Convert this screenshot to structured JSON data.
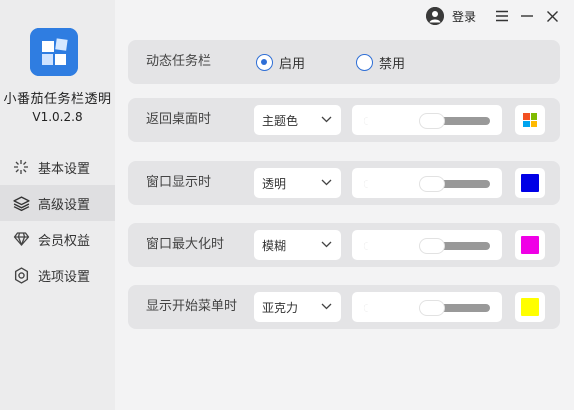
{
  "app": {
    "name": "小番茄任务栏透明",
    "version": "V1.0.2.8"
  },
  "sidebar": {
    "items": [
      {
        "label": "基本设置",
        "icon": "sparkle-icon",
        "active": false
      },
      {
        "label": "高级设置",
        "icon": "layers-icon",
        "active": true
      },
      {
        "label": "会员权益",
        "icon": "diamond-icon",
        "active": false
      },
      {
        "label": "选项设置",
        "icon": "gear-icon",
        "active": false
      }
    ]
  },
  "header": {
    "login_label": "登录",
    "icons": [
      "avatar-icon",
      "menu-icon",
      "minimize-icon",
      "close-icon"
    ]
  },
  "dynamic_taskbar": {
    "label": "动态任务栏",
    "options": [
      {
        "label": "启用",
        "selected": true
      },
      {
        "label": "禁用",
        "selected": false
      }
    ]
  },
  "settings_rows": [
    {
      "label": "返回桌面时",
      "mode": "主题色",
      "slider_value": 0.54,
      "color": "theme",
      "color_icon": "windows-logo-icon"
    },
    {
      "label": "窗口显示时",
      "mode": "透明",
      "slider_value": 0.54,
      "color": "#0000e6"
    },
    {
      "label": "窗口最大化时",
      "mode": "模糊",
      "slider_value": 0.54,
      "color": "#f000e6"
    },
    {
      "label": "显示开始菜单时",
      "mode": "亚克力",
      "slider_value": 0.54,
      "color": "#ffff00"
    }
  ],
  "colors": {
    "accent": "#2f6fd6",
    "logo": "#2f7de1",
    "card": "#e4e4e6",
    "sidebar": "#ececed"
  }
}
